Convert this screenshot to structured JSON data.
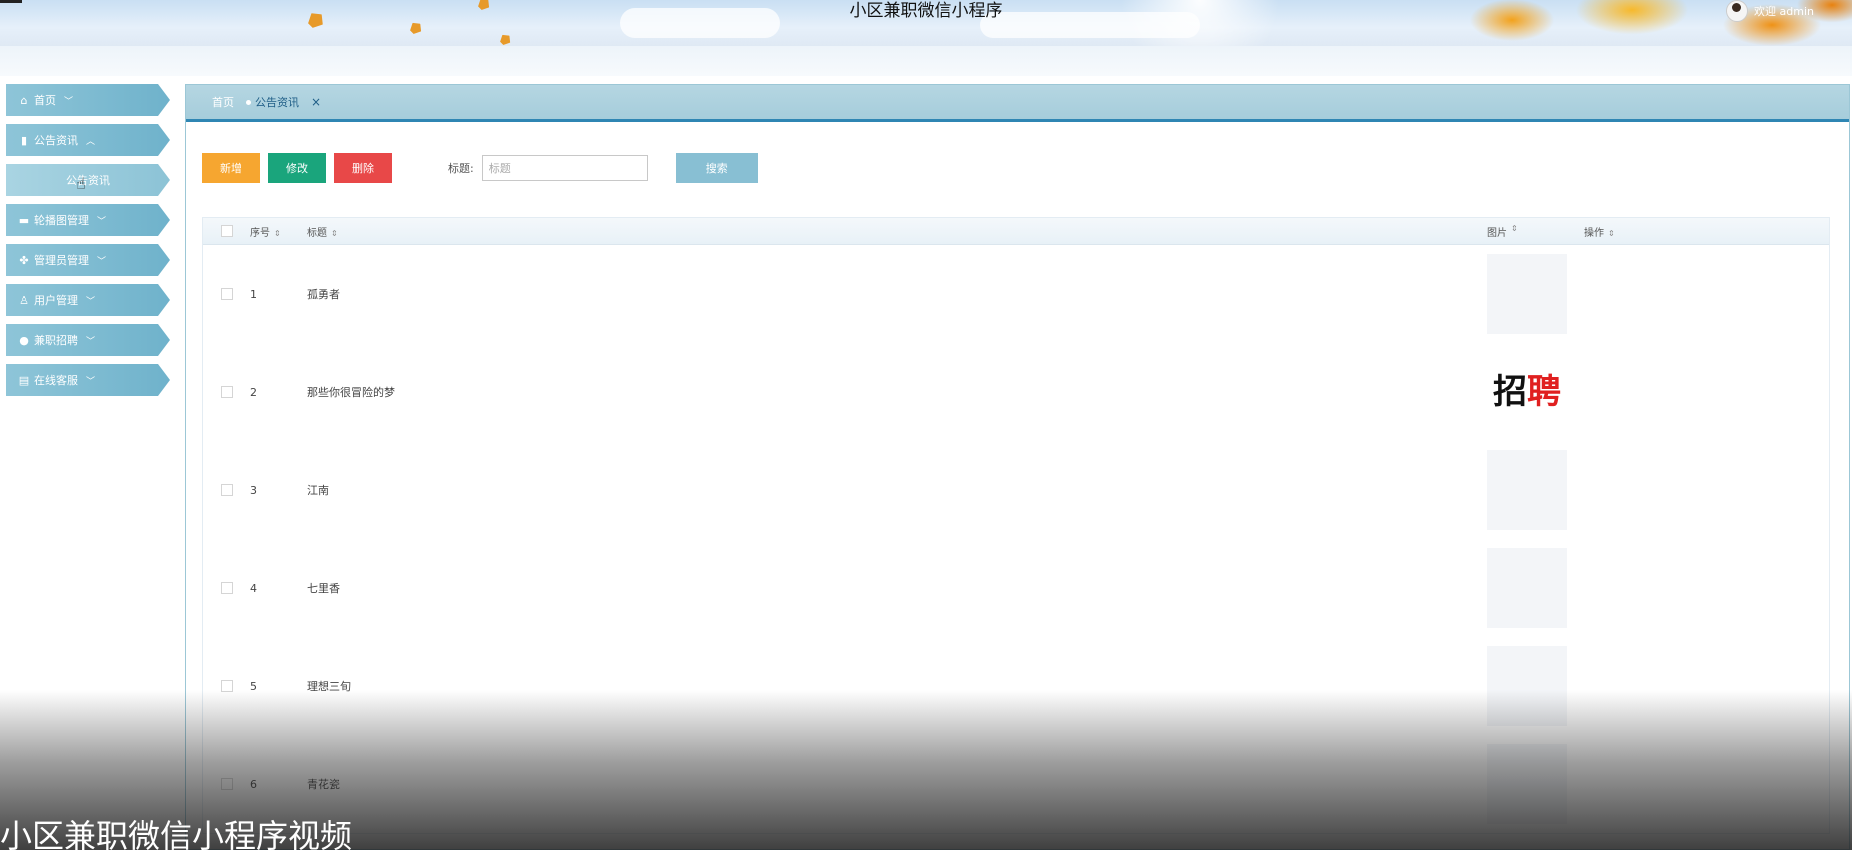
{
  "header": {
    "title": "小区兼职微信小程序",
    "welcome": "欢迎 admin"
  },
  "sidebar": {
    "items": [
      {
        "label": "首页",
        "icon": "home-icon",
        "glyph": "⌂",
        "chev": "﹀"
      },
      {
        "label": "公告资讯",
        "icon": "briefcase-icon",
        "glyph": "▮",
        "chev": "︿"
      },
      {
        "label": "公告资讯",
        "icon": "",
        "glyph": "",
        "chev": "",
        "sub": true
      },
      {
        "label": "轮播图管理",
        "icon": "image-icon",
        "glyph": "▬",
        "chev": "﹀"
      },
      {
        "label": "管理员管理",
        "icon": "grid-icon",
        "glyph": "✤",
        "chev": "﹀"
      },
      {
        "label": "用户管理",
        "icon": "user-icon",
        "glyph": "♙",
        "chev": "﹀"
      },
      {
        "label": "兼职招聘",
        "icon": "more-icon",
        "glyph": "●",
        "chev": "﹀"
      },
      {
        "label": "在线客服",
        "icon": "archive-icon",
        "glyph": "▤",
        "chev": "﹀"
      }
    ]
  },
  "tabs": {
    "home": "首页",
    "active": "公告资讯",
    "close": "×"
  },
  "toolbar": {
    "add": "新增",
    "edit": "修改",
    "delete": "删除",
    "search_label": "标题:",
    "search_placeholder": "标题",
    "search_button": "搜索"
  },
  "table": {
    "headers": {
      "no": "序号",
      "title": "标题",
      "image": "图片",
      "op": "操作"
    },
    "rows": [
      {
        "no": "1",
        "title": "孤勇者"
      },
      {
        "no": "2",
        "title": "那些你很冒险的梦"
      },
      {
        "no": "3",
        "title": "江南"
      },
      {
        "no": "4",
        "title": "七里香"
      },
      {
        "no": "5",
        "title": "理想三旬"
      },
      {
        "no": "6",
        "title": "青花瓷"
      }
    ],
    "logo": {
      "part1": "招",
      "part2": "聘"
    }
  },
  "caption": "小区兼职微信小程序视频"
}
